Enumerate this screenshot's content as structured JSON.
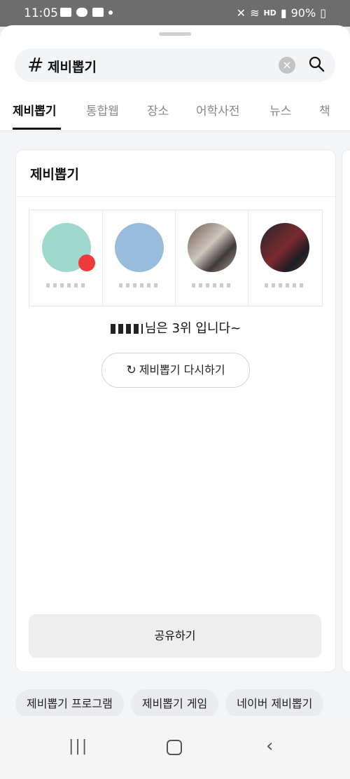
{
  "status_bar": {
    "time": "11:05",
    "battery": "90%",
    "hd_label": "HD"
  },
  "search": {
    "hash": "#",
    "query": "제비뽑기",
    "clear_icon": "close-icon",
    "search_icon": "search-icon"
  },
  "tabs": [
    {
      "label": "제비뽑기"
    },
    {
      "label": "통합웹"
    },
    {
      "label": "장소"
    },
    {
      "label": "어학사전"
    },
    {
      "label": "뉴스"
    },
    {
      "label": "책"
    }
  ],
  "card": {
    "title": "제비뽑기",
    "result_text": "님은 3위 입니다~",
    "retry_label": "제비뽑기 다시하기",
    "share_label": "공유하기"
  },
  "related": [
    "제비뽑기 프로그램",
    "제비뽑기 게임",
    "네이버 제비뽑기"
  ]
}
